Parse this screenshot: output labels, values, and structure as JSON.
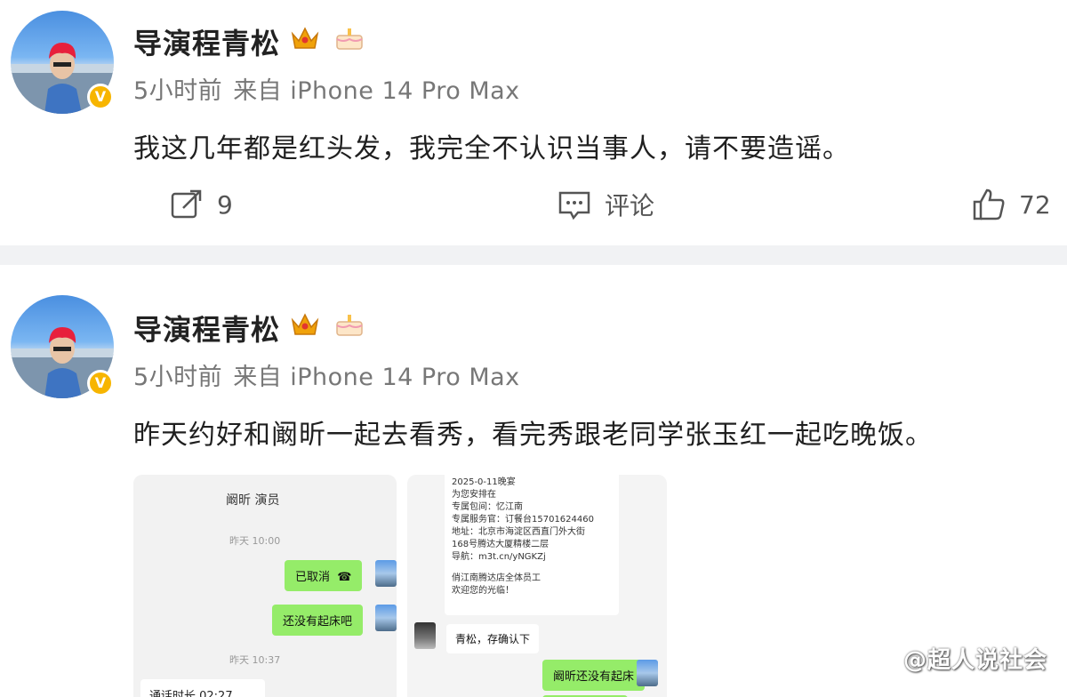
{
  "posts": [
    {
      "username": "导演程青松",
      "time": "5小时前",
      "source": "来自 iPhone 14 Pro Max",
      "content": "我这几年都是红头发，我完全不认识当事人，请不要造谣。",
      "actions": {
        "repost_count": "9",
        "comment_label": "评论",
        "like_count": "72"
      },
      "icons": {
        "repost": "share-icon",
        "comment": "comment-icon",
        "like": "thumbs-up-icon"
      }
    },
    {
      "username": "导演程青松",
      "time": "5小时前",
      "source": "来自 iPhone 14 Pro Max",
      "content": "昨天约好和阚昕一起去看秀，看完秀跟老同学张玉红一起吃晚饭。"
    }
  ],
  "screenshot1": {
    "title": "阚昕 演员",
    "ts1": "昨天 10:00",
    "msg1": "已取消",
    "msg2": "还没有起床吧",
    "ts2": "昨天 10:37",
    "call": "通话时长 02:27"
  },
  "screenshot2": {
    "notice_lines": [
      "2025-0-11晚宴",
      "为您安排在",
      "专属包间：忆江南",
      "专属服务官：订餐台15701624460",
      "地址：北京市海淀区西直门外大街",
      "168号腾达大厦精楼二层",
      "导航：m3t.cn/yNGKZj",
      "",
      "俏江南腾达店全体员工",
      "欢迎您的光临！"
    ],
    "reply": "青松，存确认下",
    "msg": "阚昕还没有起床"
  },
  "watermark": "@超人说社会",
  "colors": {
    "verified": "#f7b500",
    "wechat_green": "#95ec69",
    "divider": "#f1f2f4"
  }
}
